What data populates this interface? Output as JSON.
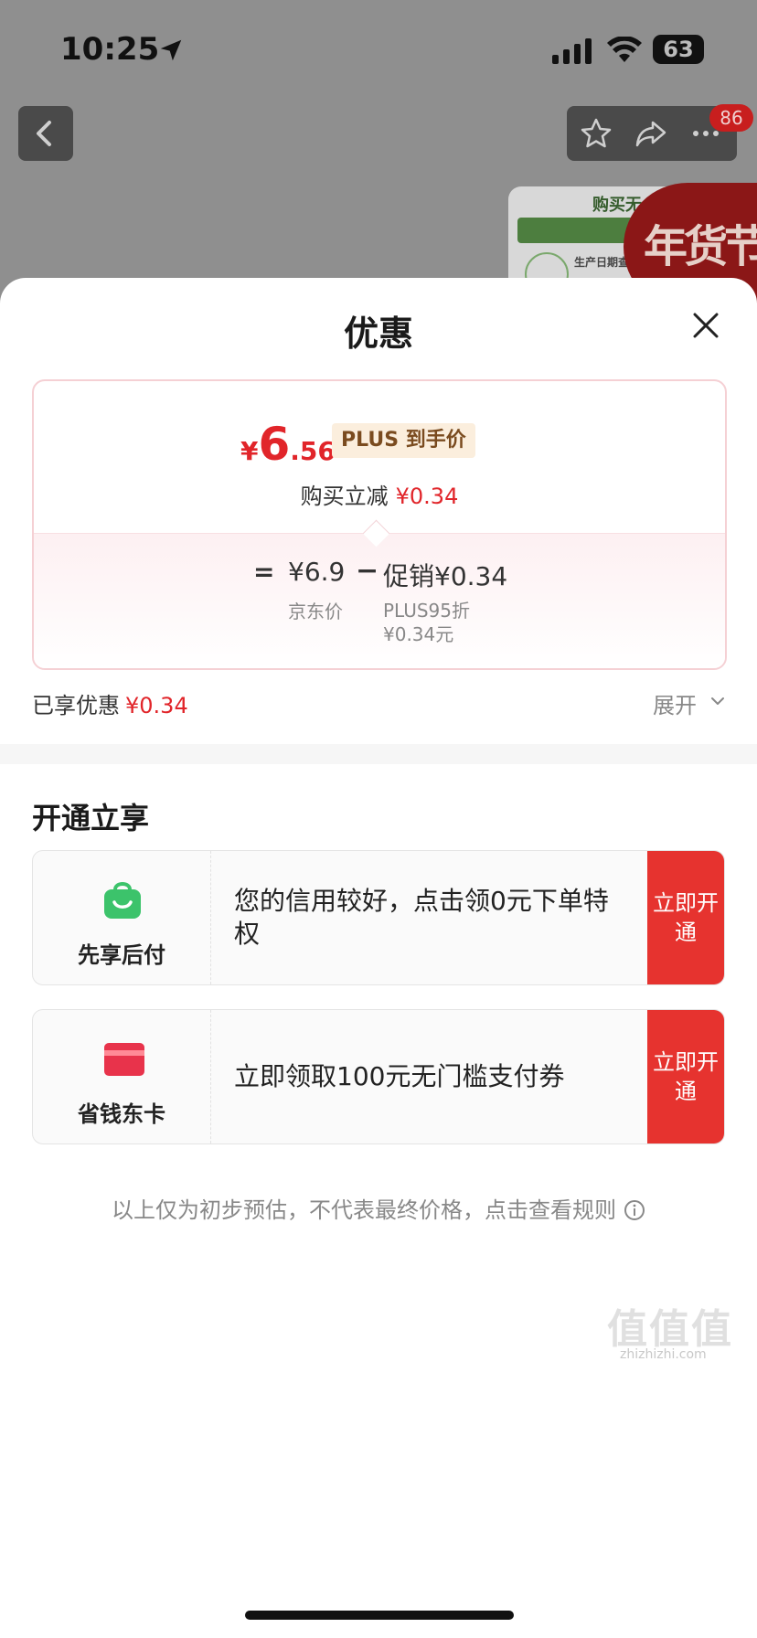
{
  "status_bar": {
    "time": "10:25",
    "battery": "63"
  },
  "nav": {
    "badge_count": "86"
  },
  "background_banner": {
    "top_text": "购买无",
    "line_text": "生产日期查",
    "festival_text": "年货节"
  },
  "sheet": {
    "title": "优惠",
    "price_card": {
      "final_price_yen": "¥",
      "final_price_int": "6",
      "final_price_dec": ".56",
      "plus_tag": "PLUS 到手价",
      "reduce_label": "购买立减",
      "reduce_amount": "¥0.34",
      "equals": "=",
      "jd_price": "¥6.9",
      "minus": "−",
      "promo_value": "促销¥0.34",
      "jd_price_label": "京东价",
      "promo_note_line1": "PLUS95折",
      "promo_note_line2": "¥0.34元"
    },
    "enjoyed": {
      "label": "已享优惠",
      "amount": "¥0.34",
      "expand": "展开"
    },
    "section_title": "开通立享",
    "offers": [
      {
        "name": "先享后付",
        "desc": "您的信用较好，点击领0元下单特权",
        "button": "立即开通"
      },
      {
        "name": "省钱东卡",
        "desc": "立即领取100元无门槛支付券",
        "button": "立即开通"
      }
    ],
    "disclaimer": "以上仅为初步预估，不代表最终价格，点击查看规则"
  },
  "watermark": {
    "main": "值值值",
    "sub": "zhizhizhi.com"
  },
  "colors": {
    "accent_red": "#e1252a",
    "button_red": "#e6332f",
    "plus_gold_bg": "#fbeedd",
    "green_bag": "#3cc36b"
  }
}
